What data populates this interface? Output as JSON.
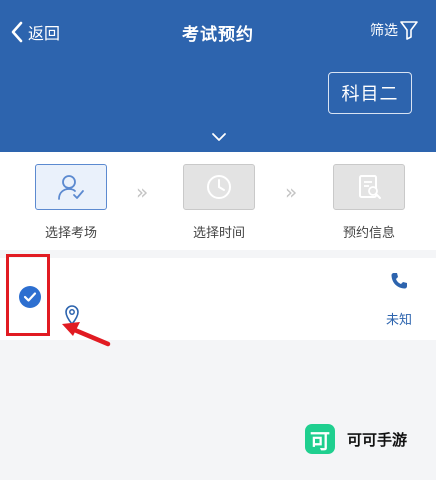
{
  "header": {
    "back_label": "返回",
    "title": "考试预约",
    "filter_label": "筛选",
    "subject_button": "科目二"
  },
  "steps": [
    {
      "label": "选择考场",
      "state": "active",
      "icon": "user-check-icon"
    },
    {
      "label": "选择时间",
      "state": "inactive",
      "icon": "clock-icon"
    },
    {
      "label": "预约信息",
      "state": "inactive",
      "icon": "document-search-icon"
    }
  ],
  "site": {
    "selected": true,
    "status_label": "未知"
  },
  "watermark": {
    "logo_char": "可",
    "text": "可可手游"
  },
  "colors": {
    "header_bg": "#2d64ae",
    "accent": "#2d6fd0",
    "highlight": "#e11b22",
    "watermark": "#1fcf8f"
  }
}
